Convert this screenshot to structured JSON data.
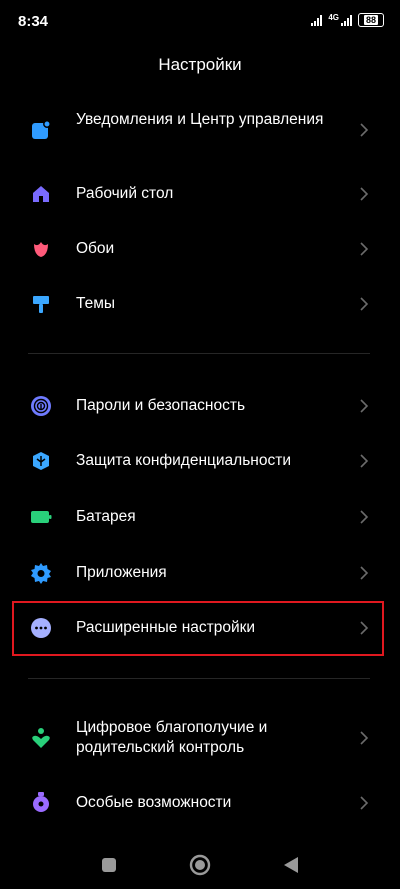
{
  "status_bar": {
    "time": "8:34",
    "network_label": "4G",
    "battery_level": "88"
  },
  "header": {
    "title": "Настройки"
  },
  "sections": [
    {
      "items": [
        {
          "label": "Уведомления и Центр управления",
          "icon": "notifications-icon",
          "icon_color": "#2f9bff"
        },
        {
          "label": "Рабочий стол",
          "icon": "home-icon",
          "icon_color": "#7a6bff"
        },
        {
          "label": "Обои",
          "icon": "wallpaper-flower-icon",
          "icon_color": "#ff5a7a"
        },
        {
          "label": "Темы",
          "icon": "themes-brush-icon",
          "icon_color": "#3ba7ff"
        }
      ]
    },
    {
      "items": [
        {
          "label": "Пароли и безопасность",
          "icon": "fingerprint-icon",
          "icon_color": "#6f7bff"
        },
        {
          "label": "Защита конфиденциальности",
          "icon": "privacy-shield-icon",
          "icon_color": "#3ba7ff"
        },
        {
          "label": "Батарея",
          "icon": "battery-icon",
          "icon_color": "#29d07a"
        },
        {
          "label": "Приложения",
          "icon": "apps-gear-icon",
          "icon_color": "#2f9bff"
        },
        {
          "label": "Расширенные настройки",
          "icon": "more-dots-icon",
          "icon_color": "#a5b0ff"
        }
      ]
    },
    {
      "items": [
        {
          "label": "Цифровое благополучие и родительский контроль",
          "icon": "wellbeing-icon",
          "icon_color": "#29d07a"
        },
        {
          "label": "Особые возможности",
          "icon": "accessibility-icon",
          "icon_color": "#9a6bff"
        }
      ]
    }
  ],
  "highlighted_item": "Расширенные настройки",
  "colors": {
    "background": "#000000",
    "text": "#ffffff",
    "chevron": "#6b6b6b",
    "divider": "#262626",
    "highlight_border": "#e0181f"
  },
  "nav": {
    "recents": "square-recents-icon",
    "home": "circle-home-icon",
    "back": "triangle-back-icon"
  }
}
